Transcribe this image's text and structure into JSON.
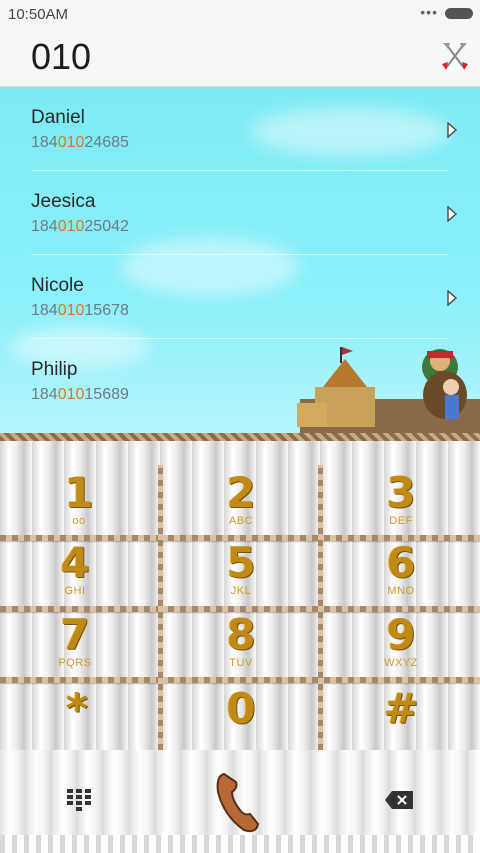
{
  "status_bar": {
    "time": "10:50AM",
    "indicator": "•••"
  },
  "dial": {
    "number": "010"
  },
  "results": [
    {
      "name": "Daniel",
      "prefix": "184",
      "match": "010",
      "suffix": "24685"
    },
    {
      "name": "Jeesica",
      "prefix": "184",
      "match": "010",
      "suffix": "25042"
    },
    {
      "name": "Nicole",
      "prefix": "184",
      "match": "010",
      "suffix": "15678"
    },
    {
      "name": "Philip",
      "prefix": "184",
      "match": "010",
      "suffix": "15689"
    }
  ],
  "keypad": [
    {
      "digit": "1",
      "letters": ""
    },
    {
      "digit": "2",
      "letters": "ABC"
    },
    {
      "digit": "3",
      "letters": "DEF"
    },
    {
      "digit": "4",
      "letters": "GHI"
    },
    {
      "digit": "5",
      "letters": "JKL"
    },
    {
      "digit": "6",
      "letters": "MNO"
    },
    {
      "digit": "7",
      "letters": "PQRS"
    },
    {
      "digit": "8",
      "letters": "TUV"
    },
    {
      "digit": "9",
      "letters": "WXYZ"
    },
    {
      "digit": "*",
      "letters": ""
    },
    {
      "digit": "0",
      "letters": ""
    },
    {
      "digit": "#",
      "letters": ""
    }
  ],
  "bottom_bar": {
    "icons": [
      "dialpad-toggle-icon",
      "phone-handset-icon",
      "backspace-icon"
    ]
  },
  "colors": {
    "sky": "#8af0fb",
    "match_highlight": "#e0781a",
    "gold": "#c08a18",
    "rope": "#a7896a"
  }
}
